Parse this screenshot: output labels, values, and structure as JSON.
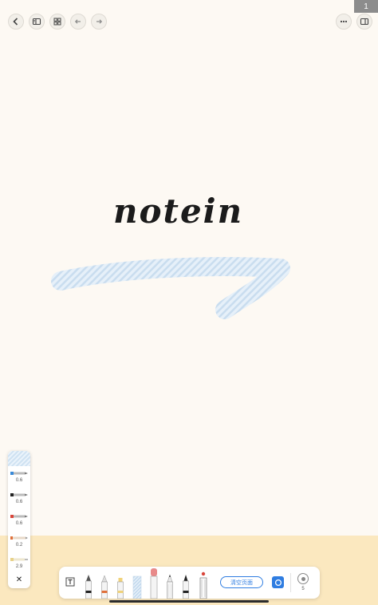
{
  "canvas": {
    "handwriting": "notein",
    "highlight_color": "#cfe2f2",
    "ink_color": "#1b1b1b",
    "page_color": "#fdf9f3",
    "band_color": "#fbe8bf"
  },
  "topbar": {
    "back_icon": "chevron-left-icon",
    "sidebar_icon": "sidebar-icon",
    "grid_icon": "grid-icon",
    "undo_icon": "undo-icon",
    "redo_icon": "redo-icon",
    "more_icon": "more-icon",
    "panel_icon": "panel-icon",
    "page_number": "1"
  },
  "pen_panel": {
    "pens": [
      {
        "size": "0.6",
        "color": "#3a8ad8"
      },
      {
        "size": "0.6",
        "color": "#222222"
      },
      {
        "size": "0.6",
        "color": "#d9463b"
      },
      {
        "size": "0.2",
        "color": "#e0703a"
      },
      {
        "size": "2.9",
        "color": "#e8d28a"
      }
    ],
    "close_label": "✕"
  },
  "toolbar": {
    "clear_label": "清空页面",
    "eraser_size": "5",
    "accent": "#2f7de1"
  }
}
